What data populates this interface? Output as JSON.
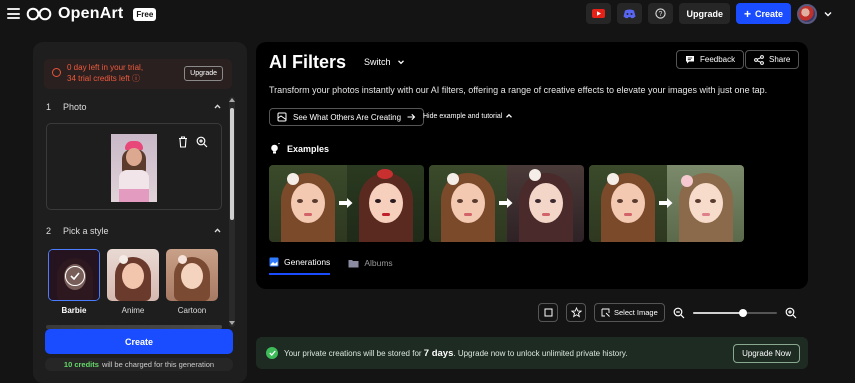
{
  "header": {
    "app_name": "OpenArt",
    "badge": "Free",
    "upgrade_label": "Upgrade",
    "create_label": "Create",
    "icons": [
      "youtube-icon",
      "discord-icon",
      "help-icon"
    ]
  },
  "sidebar": {
    "trial": {
      "line1": "0 day left in your trial,",
      "line2": "34 trial credits left",
      "upgrade_label": "Upgrade"
    },
    "photo_section": {
      "number": "1",
      "title": "Photo"
    },
    "style_section": {
      "number": "2",
      "title": "Pick a style"
    },
    "styles": [
      {
        "label": "Barbie",
        "selected": true
      },
      {
        "label": "Anime",
        "selected": false
      },
      {
        "label": "Cartoon",
        "selected": false
      }
    ],
    "create_label": "Create",
    "credits_highlight": "10 credits",
    "credits_rest": "will be charged for this generation"
  },
  "main": {
    "title": "AI Filters",
    "switch_label": "Switch",
    "feedback_label": "Feedback",
    "share_label": "Share",
    "description": "Transform your photos instantly with our AI filters, offering a range of creative effects to elevate your images with just one tap.",
    "see_others_label": "See What Others Are Creating",
    "hide_example_label": "Hide example and tutorial",
    "examples_title": "Examples",
    "tabs": [
      {
        "label": "Generations",
        "active": true
      },
      {
        "label": "Albums",
        "active": false
      }
    ]
  },
  "toolbar": {
    "select_image_label": "Select Image",
    "zoom_level": 0.6
  },
  "banner": {
    "text_before": "Your private creations will be stored for",
    "days": "7 days",
    "text_after": ". Upgrade now to unlock unlimited private history.",
    "button_label": "Upgrade Now"
  },
  "colors": {
    "accent": "#1a4dff",
    "trial_red": "#ef5a3c",
    "success_green": "#3ebc5a",
    "credits_green": "#65d86a"
  }
}
